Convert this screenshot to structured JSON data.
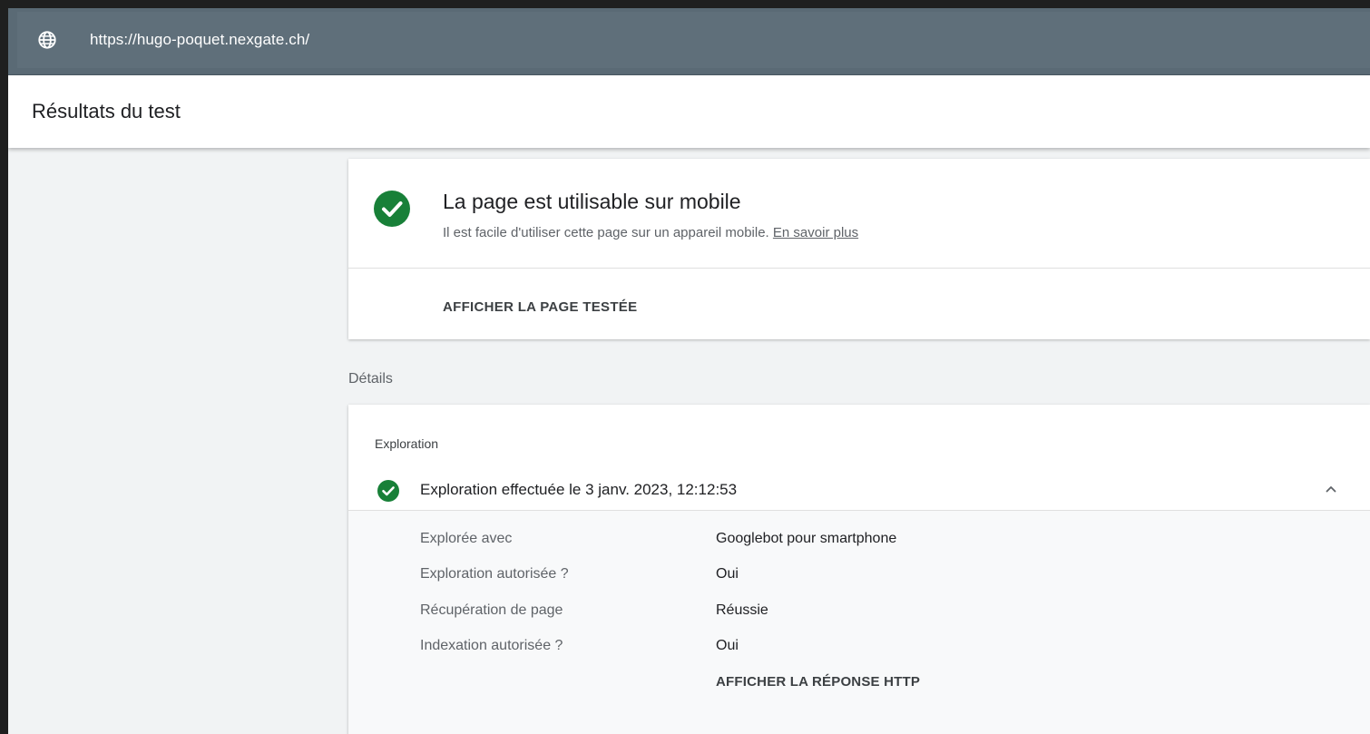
{
  "urlbar": {
    "url": "https://hugo-poquet.nexgate.ch/",
    "icon": "globe-icon"
  },
  "header": {
    "title": "Résultats du test"
  },
  "result": {
    "status_icon": "check-circle-icon",
    "status_color": "#188038",
    "title": "La page est utilisable sur mobile",
    "subtitle": "Il est facile d'utiliser cette page sur un appareil mobile.",
    "learn_more": "En savoir plus",
    "view_page_button": "AFFICHER LA PAGE TESTÉE"
  },
  "details": {
    "label": "Détails",
    "section_label": "Exploration",
    "crawl_summary": "Exploration effectuée le 3 janv. 2023, 12:12:53",
    "rows": [
      {
        "key": "Explorée avec",
        "value": "Googlebot pour smartphone"
      },
      {
        "key": "Exploration autorisée ?",
        "value": "Oui"
      },
      {
        "key": "Récupération de page",
        "value": "Réussie"
      },
      {
        "key": "Indexation autorisée ?",
        "value": "Oui"
      }
    ],
    "http_button": "AFFICHER LA RÉPONSE HTTP"
  }
}
